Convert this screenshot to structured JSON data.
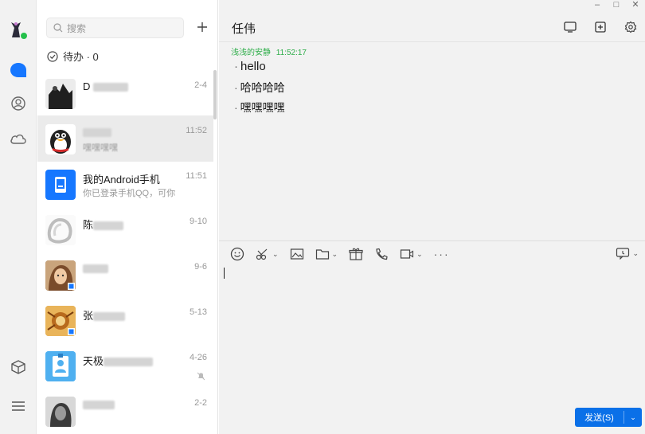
{
  "sidebar": {
    "icons": [
      "app-logo-icon",
      "chat-bubble-icon",
      "contacts-icon",
      "cloud-icon",
      "box-icon",
      "menu-icon"
    ],
    "accent": "#1677ff"
  },
  "list": {
    "search_placeholder": "搜索",
    "todo_label": "待办 · 0",
    "items": [
      {
        "name": "D",
        "sub": "",
        "time": "2-4"
      },
      {
        "name": "",
        "sub": "嘿嘿嘿嘿",
        "time": "11:52"
      },
      {
        "name": "我的Android手机",
        "sub": "你已登录手机QQ，可你",
        "time": "11:51"
      },
      {
        "name": "陈",
        "sub": "",
        "time": "9-10"
      },
      {
        "name": "",
        "sub": "",
        "time": "9-6"
      },
      {
        "name": "张",
        "sub": "",
        "time": "5-13"
      },
      {
        "name": "天极",
        "sub": "",
        "time": "4-26"
      },
      {
        "name": "",
        "sub": "",
        "time": "2-2"
      }
    ]
  },
  "chat": {
    "title": "任伟",
    "sender": "浅浅的安静",
    "sender_time": "11:52:17",
    "sender_color": "#2fae4a",
    "messages": [
      "hello",
      "哈哈哈哈",
      "嘿嘿嘿嘿"
    ],
    "send_label": "发送(S)",
    "send_color": "#0a70e8"
  }
}
